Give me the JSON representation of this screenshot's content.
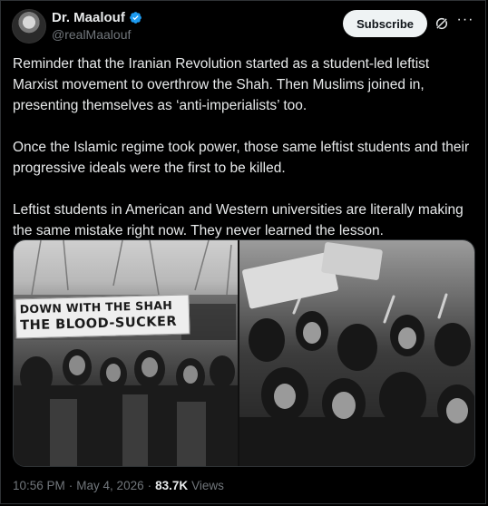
{
  "author": {
    "name": "Dr. Maalouf",
    "handle": "@realMaalouf"
  },
  "actions": {
    "subscribe_label": "Subscribe",
    "grok_icon": "grok-icon",
    "more_icon": "more-options-icon"
  },
  "tweet": {
    "paragraphs": [
      "Reminder that the Iranian Revolution started as a student-led leftist Marxist movement to overthrow the Shah. Then Muslims joined in, presenting themselves as ‘anti-imperialists’ too.",
      "Once the Islamic regime took power, those same leftist students and their progressive ideals were the first to be killed.",
      "Leftist students in American and Western universities are literally making the same mistake right now. They never learned the lesson."
    ]
  },
  "media": {
    "banner_line1": "DOWN WITH THE SHAH",
    "banner_line2": "THE BLOOD-SUCKER"
  },
  "meta": {
    "time": "10:56 PM",
    "sep1": "·",
    "date": "May 4, 2026",
    "sep2": "·",
    "views_count": "83.7K",
    "views_label": "Views"
  },
  "colors": {
    "background": "#000000",
    "text": "#e7e9ea",
    "secondary": "#71767b",
    "verified": "#1d9bf0",
    "subscribe_bg": "#eff3f4"
  }
}
